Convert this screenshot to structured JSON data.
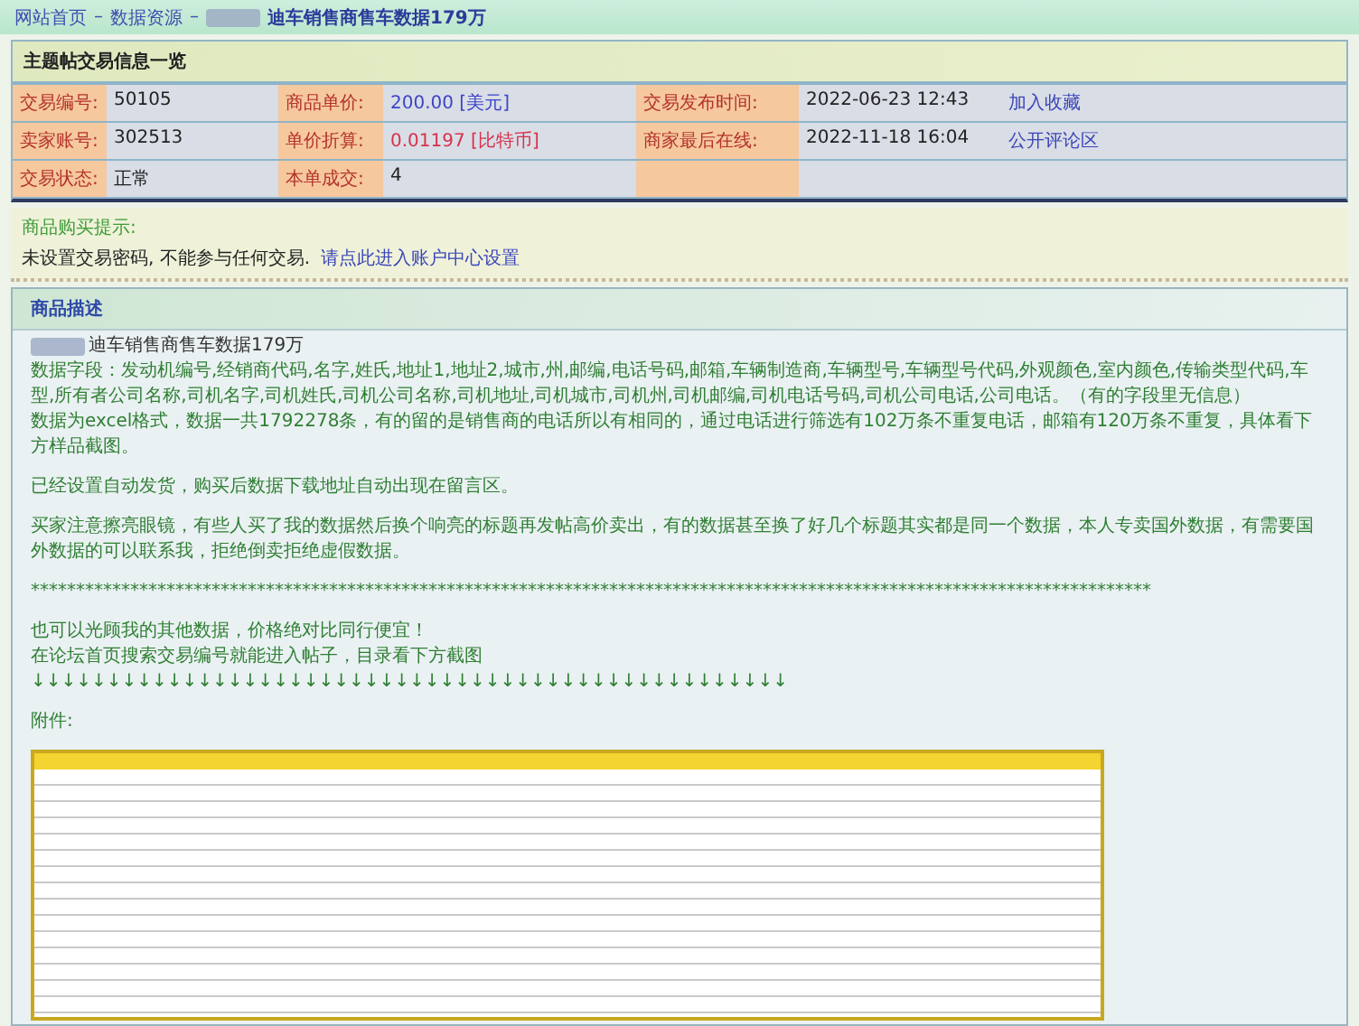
{
  "breadcrumb": [
    {
      "kind": "link",
      "text": "网站首页"
    },
    {
      "kind": "sep",
      "text": "–"
    },
    {
      "kind": "link",
      "text": "数据资源"
    },
    {
      "kind": "sep",
      "text": "–"
    },
    {
      "kind": "redacted"
    },
    {
      "kind": "title",
      "text": "迪车销售商售车数据179万"
    }
  ],
  "trade_info": {
    "title": "主题帖交易信息一览",
    "rows": [
      {
        "cells": [
          {
            "label": "交易编号:",
            "value": "50105",
            "kind": "plain"
          },
          {
            "label": "商品单价:",
            "value": "200.00",
            "unit": "[美元]",
            "kind": "price"
          },
          {
            "label": "交易发布时间:",
            "value": "2022-06-23 12:43",
            "kind": "plain"
          }
        ],
        "link": "加入收藏"
      },
      {
        "cells": [
          {
            "label": "卖家账号:",
            "value": "302513",
            "kind": "plain"
          },
          {
            "label": "单价折算:",
            "value": "0.01197",
            "unit": "[比特币]",
            "kind": "crypto"
          },
          {
            "label": "商家最后在线:",
            "value": "2022-11-18 16:04",
            "kind": "plain"
          }
        ],
        "link": "公开评论区"
      },
      {
        "cells": [
          {
            "label": "交易状态:",
            "value": "正常",
            "kind": "plain"
          },
          {
            "label": "本单成交:",
            "value": "4",
            "kind": "plain"
          }
        ]
      }
    ]
  },
  "purchase_tip": {
    "title": "商品购买提示:",
    "text": "未设置交易密码, 不能参与任何交易.",
    "link": "请点此进入账户中心设置"
  },
  "description": {
    "title": "商品描述",
    "blocks": [
      {
        "lines": [
          {
            "text": "迪车销售商售车数据179万",
            "redacted": true
          },
          {
            "text": "数据字段：发动机编号,经销商代码,名字,姓氏,地址1,地址2,城市,州,邮编,电话号码,邮箱,车辆制造商,车辆型号,车辆型号代码,外观颜色,室内颜色,传输类型代码,车型,所有者公司名称,司机名字,司机姓氏,司机公司名称,司机地址,司机城市,司机州,司机邮编,司机电话号码,司机公司电话,公司电话。（有的字段里无信息）",
            "redacted": false
          },
          {
            "text": "数据为excel格式，数据一共1792278条，有的留的是销售商的电话所以有相同的，通过电话进行筛选有102万条不重复电话，邮箱有120万条不重复，具体看下方样品截图。",
            "redacted": false
          }
        ]
      },
      {
        "lines": [
          {
            "text": "已经设置自动发货，购买后数据下载地址自动出现在留言区。",
            "redacted": false
          }
        ]
      },
      {
        "lines": [
          {
            "text": "买家注意擦亮眼镜，有些人买了我的数据然后换个响亮的标题再发帖高价卖出，有的数据甚至换了好几个标题其实都是同一个数据，本人专卖国外数据，有需要国外数据的可以联系我，拒绝倒卖拒绝虚假数据。",
            "redacted": false
          }
        ]
      },
      {
        "lines": [
          {
            "text": "****************************************************************************************************************************",
            "redacted": false
          }
        ]
      },
      {
        "lines": [
          {
            "text": "也可以光顾我的其他数据，价格绝对比同行便宜！",
            "redacted": false
          },
          {
            "text": "在论坛首页搜索交易编号就能进入帖子，目录看下方截图",
            "redacted": false
          },
          {
            "text": "↓↓↓↓↓↓↓↓↓↓↓↓↓↓↓↓↓↓↓↓↓↓↓↓↓↓↓↓↓↓↓↓↓↓↓↓↓↓↓↓↓↓↓↓↓↓↓↓↓↓",
            "redacted": false
          }
        ]
      }
    ],
    "attachment_label": "附件:"
  }
}
